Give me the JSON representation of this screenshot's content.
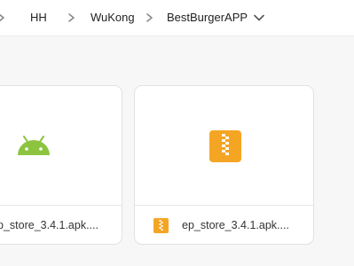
{
  "breadcrumb": {
    "items": [
      "HH",
      "WuKong",
      "BestBurgerAPP"
    ]
  },
  "files": [
    {
      "name": "p_store_3.4.1.apk....",
      "type": "android-apk"
    },
    {
      "name": "ep_store_3.4.1.apk....",
      "type": "archive"
    }
  ],
  "colors": {
    "android_green": "#8cc440",
    "archive_orange": "#f5a524",
    "chevron": "#8a8a8a"
  }
}
